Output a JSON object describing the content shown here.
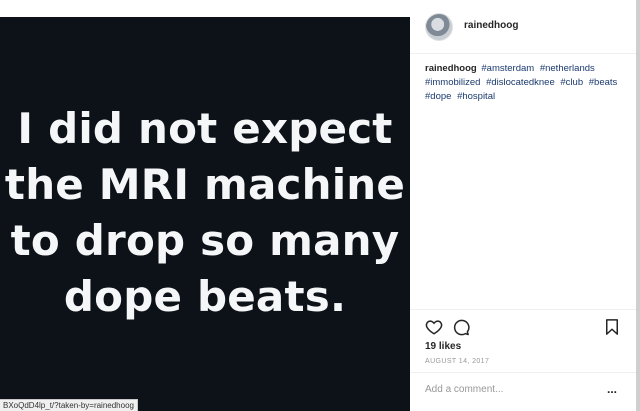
{
  "post": {
    "image_text_lines": [
      "I did not expect",
      "the MRI machine",
      "to drop so many",
      "dope beats."
    ]
  },
  "header": {
    "username": "rainedhoog",
    "avatar_icon": "avatar-photo"
  },
  "caption": {
    "author": "rainedhoog",
    "hashtags": [
      "#amsterdam",
      "#netherlands",
      "#immobilized",
      "#dislocatedknee",
      "#club",
      "#beats",
      "#dope",
      "#hospital"
    ]
  },
  "actions": {
    "like_icon": "heart-icon",
    "comment_icon": "comment-bubble-icon",
    "save_icon": "bookmark-icon",
    "likes": "19 likes",
    "date": "AUGUST 14, 2017"
  },
  "add_comment": {
    "placeholder": "Add a comment...",
    "more_label": "..."
  },
  "status_bar": {
    "url": "BXoQdD4lp_t/?taken-by=rainedhoog"
  },
  "colors": {
    "image_bg": "#0d1218",
    "image_text": "#f4f6f8",
    "hashtag": "#1b3a6e"
  }
}
